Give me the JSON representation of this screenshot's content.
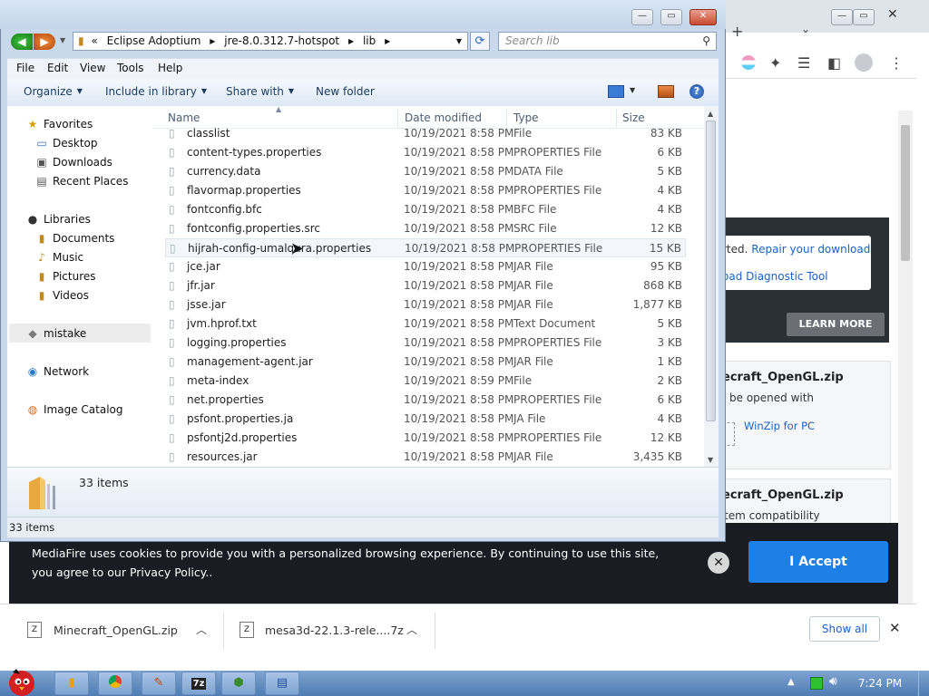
{
  "explorer": {
    "breadcrumb": [
      "«",
      "Eclipse Adoptium",
      "jre-8.0.312.7-hotspot",
      "lib"
    ],
    "search_placeholder": "Search lib",
    "menu": [
      "File",
      "Edit",
      "View",
      "Tools",
      "Help"
    ],
    "commands": [
      {
        "label": "Organize",
        "dropdown": true
      },
      {
        "label": "Include in library",
        "dropdown": true
      },
      {
        "label": "Share with",
        "dropdown": true
      },
      {
        "label": "New folder",
        "dropdown": false
      }
    ],
    "nav": {
      "favorites": "Favorites",
      "desktop": "Desktop",
      "downloads": "Downloads",
      "recent": "Recent Places",
      "libraries": "Libraries",
      "documents": "Documents",
      "music": "Music",
      "pictures": "Pictures",
      "videos": "Videos",
      "mistake": "mistake",
      "network": "Network",
      "catalog": "Image Catalog"
    },
    "columns": {
      "name": "Name",
      "date": "Date modified",
      "type": "Type",
      "size": "Size"
    },
    "files": [
      {
        "name": "classlist",
        "date": "10/19/2021 8:58 PM",
        "type": "File",
        "size": "83 KB"
      },
      {
        "name": "content-types.properties",
        "date": "10/19/2021 8:58 PM",
        "type": "PROPERTIES File",
        "size": "6 KB"
      },
      {
        "name": "currency.data",
        "date": "10/19/2021 8:58 PM",
        "type": "DATA File",
        "size": "5 KB"
      },
      {
        "name": "flavormap.properties",
        "date": "10/19/2021 8:58 PM",
        "type": "PROPERTIES File",
        "size": "4 KB"
      },
      {
        "name": "fontconfig.bfc",
        "date": "10/19/2021 8:58 PM",
        "type": "BFC File",
        "size": "4 KB"
      },
      {
        "name": "fontconfig.properties.src",
        "date": "10/19/2021 8:58 PM",
        "type": "SRC File",
        "size": "12 KB"
      },
      {
        "name": "hijrah-config-umalqura.properties",
        "date": "10/19/2021 8:58 PM",
        "type": "PROPERTIES File",
        "size": "15 KB"
      },
      {
        "name": "jce.jar",
        "date": "10/19/2021 8:58 PM",
        "type": "JAR File",
        "size": "95 KB"
      },
      {
        "name": "jfr.jar",
        "date": "10/19/2021 8:58 PM",
        "type": "JAR File",
        "size": "868 KB"
      },
      {
        "name": "jsse.jar",
        "date": "10/19/2021 8:58 PM",
        "type": "JAR File",
        "size": "1,877 KB"
      },
      {
        "name": "jvm.hprof.txt",
        "date": "10/19/2021 8:58 PM",
        "type": "Text Document",
        "size": "5 KB"
      },
      {
        "name": "logging.properties",
        "date": "10/19/2021 8:58 PM",
        "type": "PROPERTIES File",
        "size": "3 KB"
      },
      {
        "name": "management-agent.jar",
        "date": "10/19/2021 8:58 PM",
        "type": "JAR File",
        "size": "1 KB"
      },
      {
        "name": "meta-index",
        "date": "10/19/2021 8:59 PM",
        "type": "File",
        "size": "2 KB"
      },
      {
        "name": "net.properties",
        "date": "10/19/2021 8:58 PM",
        "type": "PROPERTIES File",
        "size": "6 KB"
      },
      {
        "name": "psfont.properties.ja",
        "date": "10/19/2021 8:58 PM",
        "type": "JA File",
        "size": "4 KB"
      },
      {
        "name": "psfontj2d.properties",
        "date": "10/19/2021 8:58 PM",
        "type": "PROPERTIES File",
        "size": "12 KB"
      },
      {
        "name": "resources.jar",
        "date": "10/19/2021 8:58 PM",
        "type": "JAR File",
        "size": "3,435 KB"
      }
    ],
    "hover_row": 6,
    "details_count": "33 items",
    "status_count": "33 items"
  },
  "browser": {
    "notice_text": "rted.",
    "repair_link": "Repair your download",
    "diag_link": "oad Diagnostic Tool",
    "learn_more": "LEARN MORE",
    "file1_name": "ecraft_OpenGL.zip",
    "file1_desc": "be opened with",
    "winzip": "WinZip for PC",
    "file2_name": "ecraft_OpenGL.zip",
    "file2_desc": "tem compatibility"
  },
  "cookie": {
    "text": "MediaFire uses cookies to provide you with a personalized browsing experience. By continuing to use this site, you agree to our Privacy Policy..",
    "accept": "I Accept",
    "close": "✕"
  },
  "downloads": {
    "items": [
      "Minecraft_OpenGL.zip",
      "mesa3d-22.1.3-rele....7z"
    ],
    "show_all": "Show all"
  },
  "taskbar": {
    "clock": "7:24 PM",
    "icons": [
      "folder-icon",
      "chrome-icon",
      "app-icon",
      "7zip-icon",
      "gem-icon",
      "window-icon"
    ]
  },
  "colors": {
    "accent": "#1e7fe6",
    "cookie_bg": "#191c22",
    "titlebar": "#c9d8ea"
  }
}
